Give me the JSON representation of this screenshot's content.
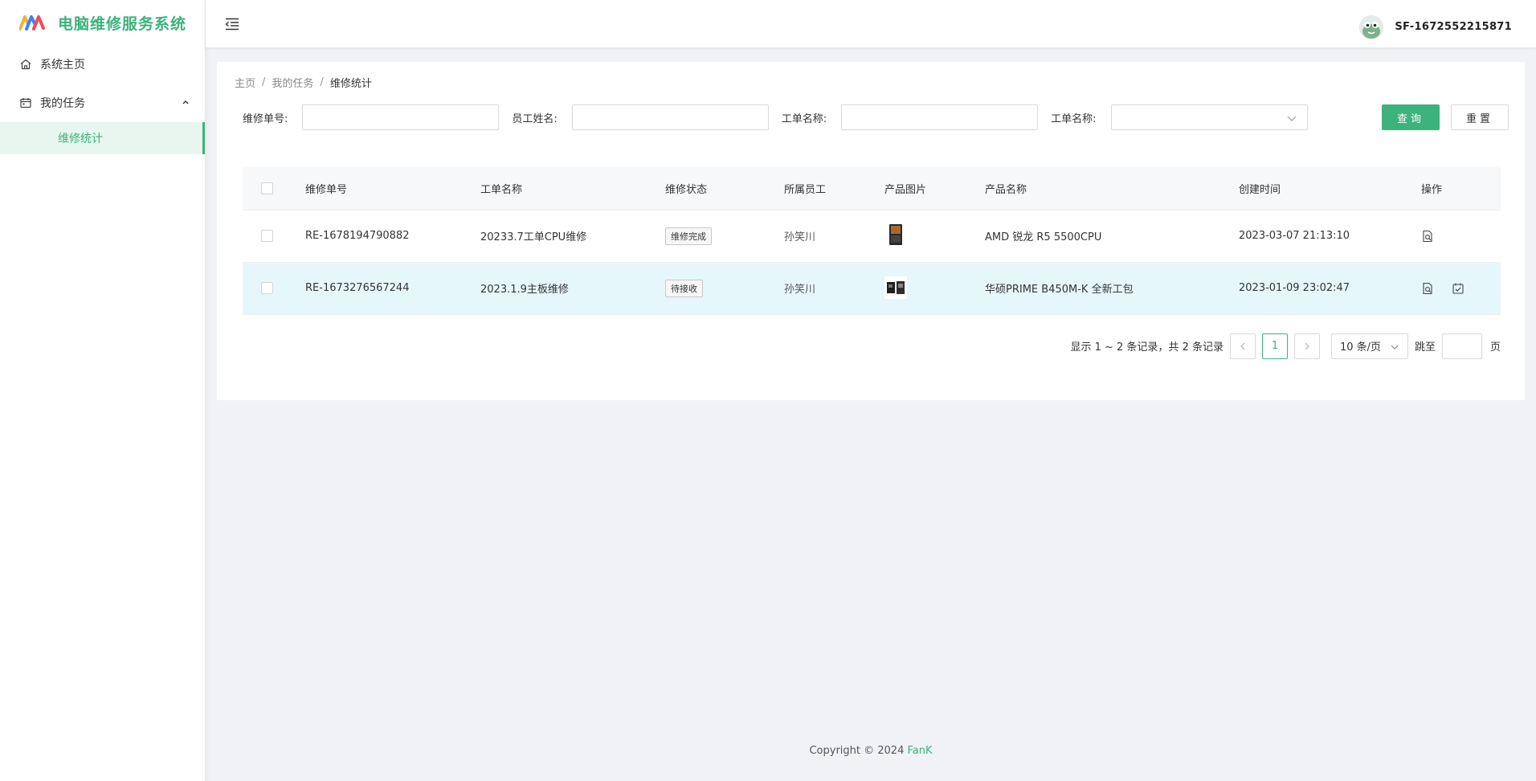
{
  "sidebar": {
    "app_title": "电脑维修服务系统",
    "items": [
      {
        "label": "系统主页",
        "icon": "home-icon"
      },
      {
        "label": "我的任务",
        "icon": "calendar-icon"
      }
    ],
    "subitems": [
      {
        "label": "维修统计"
      }
    ]
  },
  "header": {
    "user_name": "SF-1672552215871"
  },
  "breadcrumb": [
    "主页",
    "我的任务",
    "维修统计"
  ],
  "filters": {
    "repair_no_label": "维修单号:",
    "employee_label": "员工姓名:",
    "order_name_label": "工单名称:",
    "order_name2_label": "工单名称:",
    "query_label": "查询",
    "reset_label": "重置"
  },
  "table": {
    "columns": [
      "维修单号",
      "工单名称",
      "维修状态",
      "所属员工",
      "产品图片",
      "产品名称",
      "创建时间",
      "操作"
    ],
    "rows": [
      {
        "repair_no": "RE-1678194790882",
        "order_name": "20233.7工单CPU维修",
        "status": "维修完成",
        "employee": "孙笑川",
        "product": "AMD 锐龙 R5 5500CPU",
        "created": "2023-03-07 21:13:10"
      },
      {
        "repair_no": "RE-1673276567244",
        "order_name": "2023.1.9主板维修",
        "status": "待接收",
        "employee": "孙笑川",
        "product": "华硕PRIME B450M-K 全新工包",
        "created": "2023-01-09 23:02:47"
      }
    ]
  },
  "pager": {
    "summary": "显示 1 ~ 2 条记录，共 2 条记录",
    "current_page": "1",
    "page_size": "10 条/页",
    "jump_label": "跳至",
    "page_suffix": "页"
  },
  "footer": {
    "text": "Copyright © 2024 ",
    "brand": "FanK"
  },
  "colors": {
    "accent": "#3cb37a",
    "row_highlight": "#e6f7fc"
  }
}
